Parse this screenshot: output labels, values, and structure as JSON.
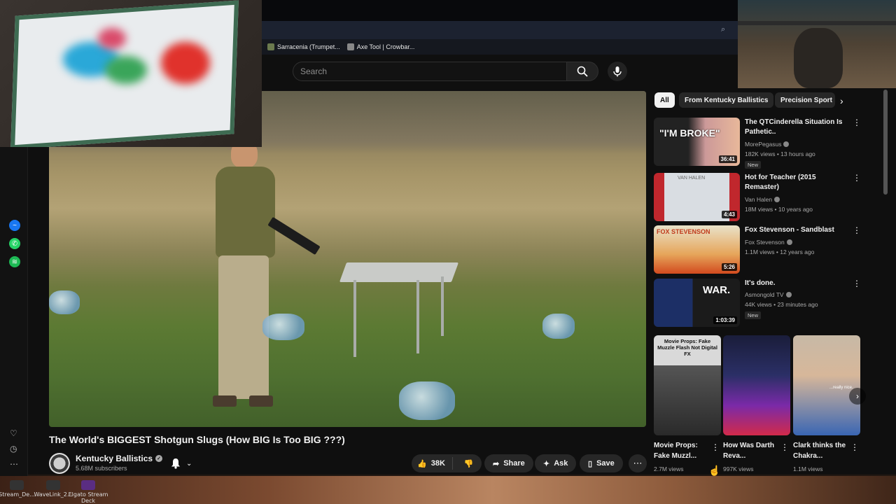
{
  "browser": {
    "bookmarks": [
      {
        "label": "Sarracenia (Trumpet..."
      },
      {
        "label": "Axe Tool | Crowbar..."
      }
    ]
  },
  "search": {
    "placeholder": "Search",
    "search_icon": "search-icon",
    "mic_icon": "mic-icon"
  },
  "video": {
    "title": "The World's BIGGEST Shotgun Slugs (How BIG Is Too BIG ???)",
    "channel": "Kentucky Ballistics",
    "subscribers": "5.68M subscribers",
    "likes": "38K",
    "share_label": "Share",
    "ask_label": "Ask",
    "save_label": "Save"
  },
  "chips": [
    {
      "label": "All",
      "active": true
    },
    {
      "label": "From Kentucky Ballistics",
      "active": false
    },
    {
      "label": "Precision Sport",
      "active": false
    }
  ],
  "recommendations": [
    {
      "title": "The QTCinderella Situation Is Pathetic..",
      "channel": "MorePegasus",
      "meta": "182K views • 13 hours ago",
      "duration": "36:41",
      "badge": "New",
      "thumb_text": "\"I'M BROKE\""
    },
    {
      "title": "Hot for Teacher (2015 Remaster)",
      "channel": "Van Halen",
      "meta": "18M views • 10 years ago",
      "duration": "4:43",
      "badge": "",
      "thumb_text": "VAN HALEN"
    },
    {
      "title": "Fox Stevenson - Sandblast",
      "channel": "Fox Stevenson",
      "meta": "1.1M views • 12 years ago",
      "duration": "5:26",
      "badge": "",
      "thumb_text": "FOX STEVENSON"
    },
    {
      "title": "It's done.",
      "channel": "Asmongold TV",
      "meta": "44K views • 23 minutes ago",
      "duration": "1:03:39",
      "badge": "New",
      "thumb_text": "WAR."
    }
  ],
  "shorts": [
    {
      "title": "Movie Props: Fake Muzzl...",
      "views": "2.7M views",
      "thumb_text": "Movie Props: Fake Muzzle Flash Not Digital FX"
    },
    {
      "title": "How Was Darth Reva...",
      "views": "997K views",
      "thumb_text": ""
    },
    {
      "title": "Clark thinks the Chakra...",
      "views": "1.1M views",
      "thumb_text": "...really nice."
    }
  ],
  "desktop": {
    "icons": [
      {
        "label": "Stream_De..."
      },
      {
        "label": "WaveLink_2..."
      },
      {
        "label": "Elgato Stream Deck"
      }
    ]
  },
  "colors": {
    "background": "#0f0f0f",
    "chip_active": "#f1f1f1",
    "pill": "#272727",
    "messenger": "#1877f2",
    "whatsapp": "#25d366",
    "spotify": "#1db954"
  }
}
